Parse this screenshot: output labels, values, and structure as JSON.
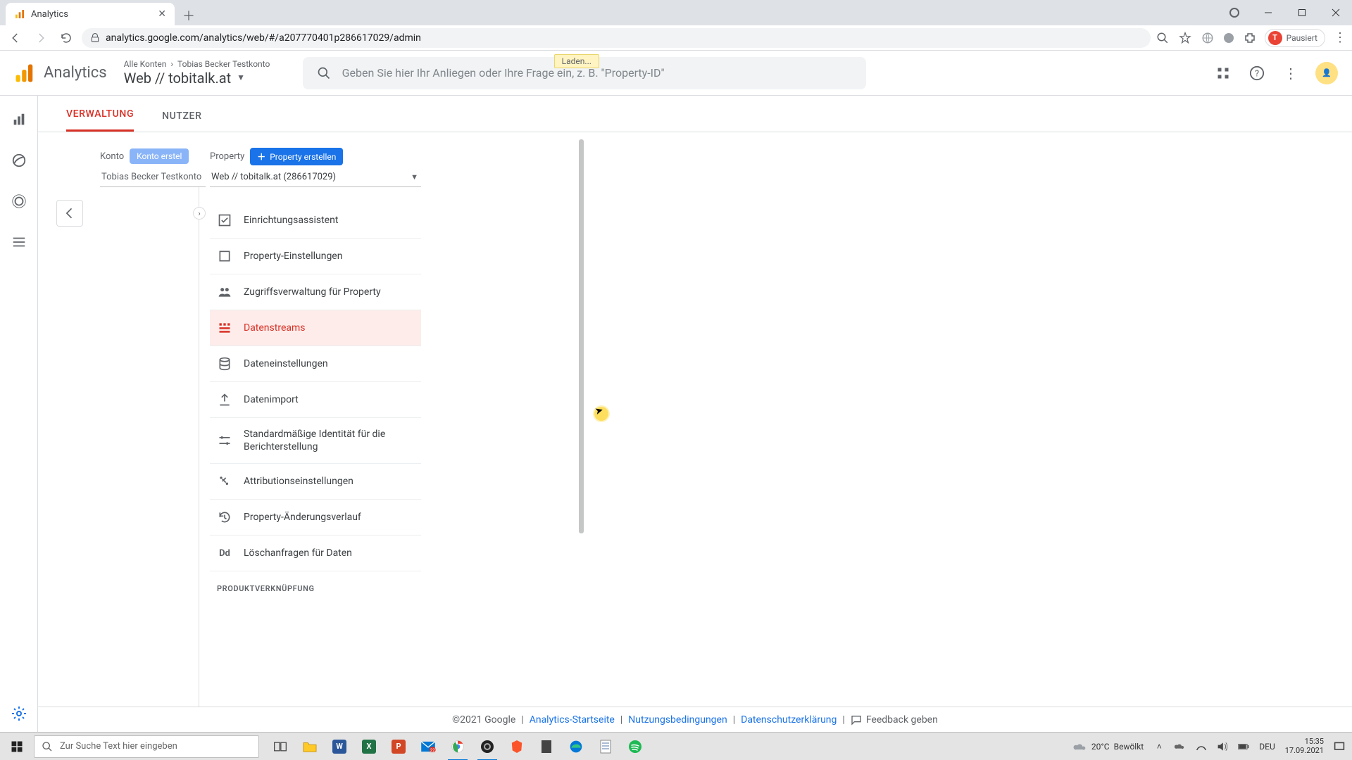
{
  "browser": {
    "tab_title": "Analytics",
    "url": "analytics.google.com/analytics/web/#/a207770401p286617029/admin",
    "profile_status": "Pausiert",
    "profile_initial": "T"
  },
  "header": {
    "product": "Analytics",
    "crumb_all": "Alle Konten",
    "crumb_account": "Tobias Becker Testkonto",
    "property_name": "Web // tobitalk.at",
    "search_placeholder": "Geben Sie hier Ihr Anliegen oder Ihre Frage ein, z. B. \"Property-ID\"",
    "loading": "Laden..."
  },
  "admin": {
    "tab_verwaltung": "VERWALTUNG",
    "tab_nutzer": "NUTZER",
    "account_label": "Konto",
    "account_chip": "Konto erstel",
    "account_select": "Tobias Becker Testkonto",
    "property_label": "Property",
    "property_chip": "Property erstellen",
    "property_select": "Web // tobitalk.at (286617029)",
    "menu": {
      "setup": "Einrichtungsassistent",
      "settings": "Property-Einstellungen",
      "access": "Zugriffsverwaltung für Property",
      "streams": "Datenstreams",
      "data_settings": "Dateneinstellungen",
      "import": "Datenimport",
      "identity": "Standardmäßige Identität für die Berichterstellung",
      "attribution": "Attributionseinstellungen",
      "history": "Property-Änderungsverlauf",
      "delete_req": "Löschanfragen für Daten",
      "section_link": "PRODUKTVERKNÜPFUNG"
    }
  },
  "footer": {
    "copyright": "©2021 Google",
    "link_start": "Analytics-Startseite",
    "link_terms": "Nutzungsbedingungen",
    "link_privacy": "Datenschutzerklärung",
    "feedback": "Feedback geben"
  },
  "taskbar": {
    "search_placeholder": "Zur Suche Text hier eingeben",
    "weather_temp": "20°C",
    "weather_text": "Bewölkt",
    "lang": "DEU",
    "time": "15:35",
    "date": "17.09.2021"
  }
}
